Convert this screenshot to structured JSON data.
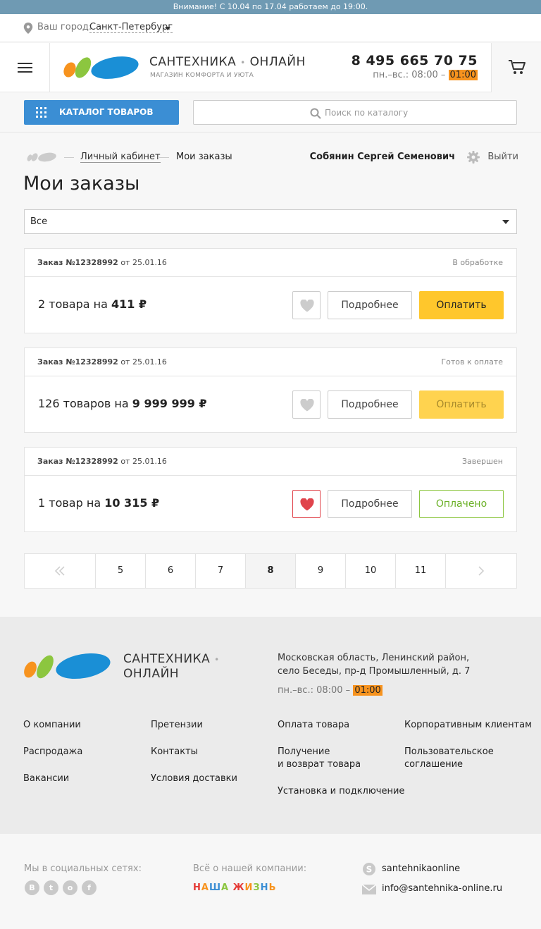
{
  "announcement": "Внимание! С 10.04 по 17.04 работаем до 19:00.",
  "city": {
    "label": "Ваш город:",
    "value": "Санкт-Петербург"
  },
  "header": {
    "brand_main": "САНТЕХНИКА",
    "brand_sub": "ОНЛАЙН",
    "tagline": "МАГАЗИН КОМФОРТА И УЮТА",
    "phone": "8 495 665 70 75",
    "hours_prefix": "пн.–вс.: 08:00 –",
    "hours_end": "01:00"
  },
  "search": {
    "catalog_label": "КАТАЛОГ ТОВАРОВ",
    "placeholder": "Поиск по каталогу"
  },
  "breadcrumbs": {
    "account": "Личный кабинет",
    "current": "Мои заказы"
  },
  "user": {
    "name": "Собянин Сергей Семенович",
    "logout": "Выйти"
  },
  "page_title": "Мои заказы",
  "filter": {
    "selected": "Все"
  },
  "orders": [
    {
      "number": "Заказ №12328992",
      "date": "от 25.01.16",
      "status": "В обработке",
      "summary": "2 товара на",
      "total": "411 ₽",
      "more": "Подробнее",
      "action": "Оплатить"
    },
    {
      "number": "Заказ №12328992",
      "date": "от 25.01.16",
      "status": "Готов к оплате",
      "summary": "126 товаров на",
      "total": "9 999 999 ₽",
      "more": "Подробнее",
      "action": "Оплатить"
    },
    {
      "number": "Заказ №12328992",
      "date": "от 25.01.16",
      "status": "Завершен",
      "summary": "1 товар на",
      "total": "10 315 ₽",
      "more": "Подробнее",
      "action": "Оплачено"
    }
  ],
  "pagination": {
    "pages": [
      "5",
      "6",
      "7",
      "8",
      "9",
      "10",
      "11"
    ],
    "current": "8"
  },
  "footer": {
    "brand_main": "САНТЕХНИКА",
    "brand_sub": "ОНЛАЙН",
    "address_line1": "Московская область, Ленинский район,",
    "address_line2": "село Беседы, пр-д Промышленный, д. 7",
    "hours_prefix": "пн.–вс.: 08:00 –",
    "hours_end": "01:00",
    "links": {
      "about": "О компании",
      "claims": "Претензии",
      "payment": "Оплата товара",
      "corporate": "Корпоративным клиентам",
      "sale": "Распродажа",
      "contacts": "Контакты",
      "receipt_1": "Получение",
      "receipt_2": "и возврат товара",
      "agreement_1": "Пользовательское",
      "agreement_2": "соглашение",
      "vacancies": "Вакансии",
      "delivery": "Условия доставки",
      "install": "Установка и подключение"
    }
  },
  "bottom": {
    "social_label": "Мы в социальных сетях:",
    "company_label": "Всё о нашей компании:",
    "nasha_letters": [
      "Н",
      "А",
      "Ш",
      "А",
      " ",
      "Ж",
      "И",
      "З",
      "Н",
      "Ь"
    ],
    "nasha_colors": [
      "#e53935",
      "#f7931e",
      "#3b8ed4",
      "#8cc63f",
      "#ffffff",
      "#e53935",
      "#f7931e",
      "#8cc63f",
      "#3b8ed4",
      "#f7931e"
    ],
    "skype": "santehnikaonline",
    "email": "info@santehnika-online.ru",
    "social_icons": [
      "vk-icon",
      "twitter-icon",
      "odnoklassniki-icon",
      "facebook-icon"
    ]
  },
  "colors": {
    "accent_blue": "#3b8ed4",
    "pay_yellow": "#ffc72c",
    "hours_orange": "#f7931e",
    "paid_green": "#8cc63f",
    "fav_red": "#e0444c"
  }
}
